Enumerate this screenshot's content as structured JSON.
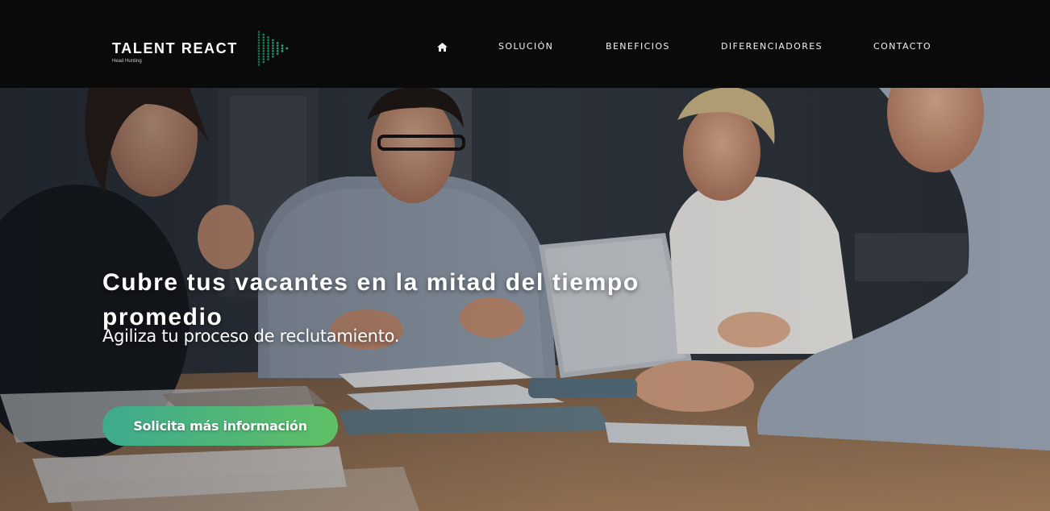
{
  "brand": {
    "name": "TALENT REACT",
    "tagline": "Head Hunting",
    "logo_icon": "dot-grid-arrow-icon",
    "accent_color": "#22c48a"
  },
  "nav": {
    "home_icon": "home-icon",
    "items": [
      "SOLUCIÓN",
      "BENEFICIOS",
      "DIFERENCIADORES",
      "CONTACTO"
    ]
  },
  "hero": {
    "title": "Cubre tus vacantes en la mitad del tiempo promedio",
    "subtitle": "Agiliza tu proceso de reclutamiento.",
    "cta_label": "Solicita más información",
    "cta_gradient": [
      "#3eaa8e",
      "#5fc064"
    ]
  }
}
